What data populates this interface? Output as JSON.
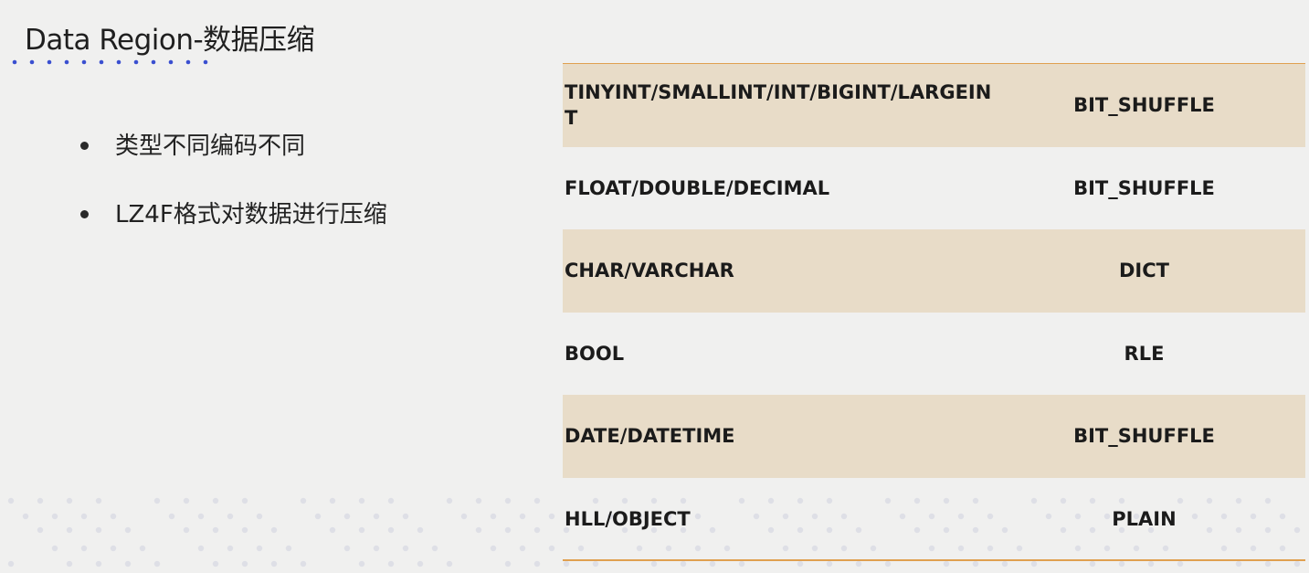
{
  "slide": {
    "title": "Data Region-数据压缩",
    "bullets": [
      "类型不同编码不同",
      "LZ4F格式对数据进行压缩"
    ]
  },
  "table": {
    "rows": [
      {
        "type": "TINYINT/SMALLINT/INT/BIGINT/LARGEINT",
        "encoding": "BIT_SHUFFLE"
      },
      {
        "type": "FLOAT/DOUBLE/DECIMAL",
        "encoding": "BIT_SHUFFLE"
      },
      {
        "type": "CHAR/VARCHAR",
        "encoding": "DICT"
      },
      {
        "type": "BOOL",
        "encoding": "RLE"
      },
      {
        "type": "DATE/DATETIME",
        "encoding": "BIT_SHUFFLE"
      },
      {
        "type": "HLL/OBJECT",
        "encoding": "PLAIN"
      }
    ]
  },
  "colors": {
    "background": "#f0f0ef",
    "row_shade": "#e8dcc8",
    "rule": "#e0a050",
    "title_dots": "#3a4fd0",
    "decor_dots": "#dcdde6"
  }
}
